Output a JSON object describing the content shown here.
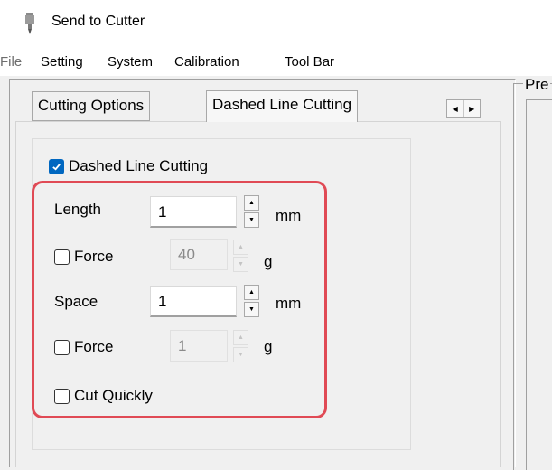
{
  "window": {
    "title": "Send to Cutter"
  },
  "menu": [
    {
      "label": "File",
      "enabled": false
    },
    {
      "label": "Setting",
      "enabled": true
    },
    {
      "label": "System",
      "enabled": true
    },
    {
      "label": "Calibration",
      "enabled": true
    },
    {
      "label": "Tool Bar",
      "enabled": true
    }
  ],
  "tabs": [
    {
      "label": "Cutting Options",
      "active": false
    },
    {
      "label": "Dashed Line Cutting",
      "active": true
    }
  ],
  "dashed": {
    "enable_label": "Dashed Line Cutting",
    "enable_checked": true,
    "length": {
      "label": "Length",
      "value": "1",
      "unit": "mm"
    },
    "length_force": {
      "label": "Force",
      "checked": false,
      "value": "40",
      "unit": "g"
    },
    "space": {
      "label": "Space",
      "value": "1",
      "unit": "mm"
    },
    "space_force": {
      "label": "Force",
      "checked": false,
      "value": "1",
      "unit": "g"
    },
    "cut_quickly": {
      "label": "Cut Quickly",
      "checked": false
    }
  },
  "preview": {
    "title": "Pre"
  },
  "colors": {
    "highlight": "#e04a55",
    "checkbox_accent": "#0067c0"
  }
}
